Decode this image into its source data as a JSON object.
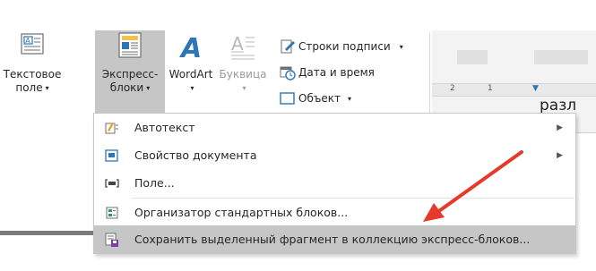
{
  "ribbon": {
    "textbox": {
      "line1": "Текстовое",
      "line2": "поле"
    },
    "quickparts": {
      "line1": "Экспресс-",
      "line2": "блоки"
    },
    "wordart": {
      "label": "WordArt"
    },
    "dropcap": {
      "label": "Буквица"
    },
    "signature_line": {
      "label": "Строки подписи"
    },
    "date_time": {
      "label": "Дата и время"
    },
    "object": {
      "label": "Объект"
    }
  },
  "ruler": {
    "marks": [
      "2",
      "1"
    ]
  },
  "document": {
    "text": "разл"
  },
  "menu": {
    "items": [
      {
        "label": "Автотекст",
        "icon": "autotext-icon",
        "submenu": true
      },
      {
        "label": "Свойство документа",
        "icon": "document-property-icon",
        "submenu": true
      },
      {
        "label": "Поле...",
        "icon": "field-icon",
        "submenu": false
      },
      {
        "label": "Организатор стандартных блоков...",
        "icon": "building-blocks-organizer-icon",
        "submenu": false
      },
      {
        "label": "Сохранить выделенный фрагмент в коллекцию экспресс-блоков...",
        "icon": "save-selection-icon",
        "submenu": false
      }
    ]
  },
  "colors": {
    "highlight": "#c6c6c6",
    "arrow": "#e53a2a",
    "accent": "#2e75b6"
  }
}
